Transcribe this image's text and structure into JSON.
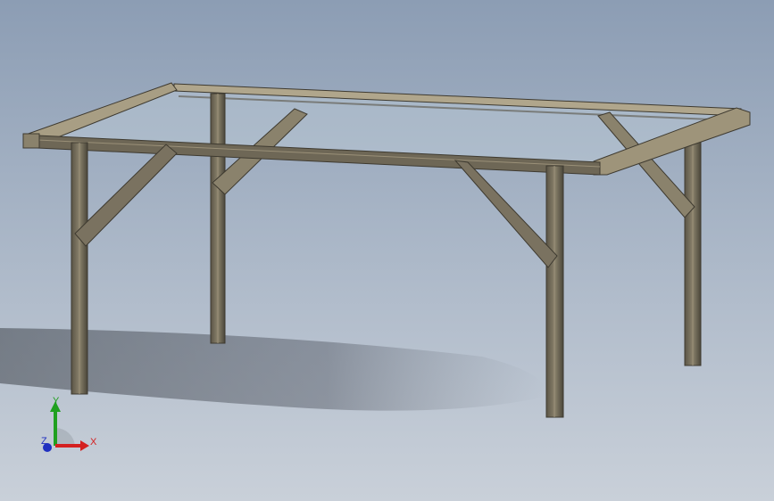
{
  "viewport": {
    "background_top": "#8c9db4",
    "background_bottom": "#c9d0d9"
  },
  "model": {
    "frame_color": "#7a7260",
    "frame_dark": "#3e3a30",
    "glass_color": "#c8d6e0"
  },
  "triad": {
    "x_label": "X",
    "y_label": "Y",
    "z_label": "Z",
    "x_color": "#d42020",
    "y_color": "#20a020",
    "z_color": "#2030c0"
  }
}
